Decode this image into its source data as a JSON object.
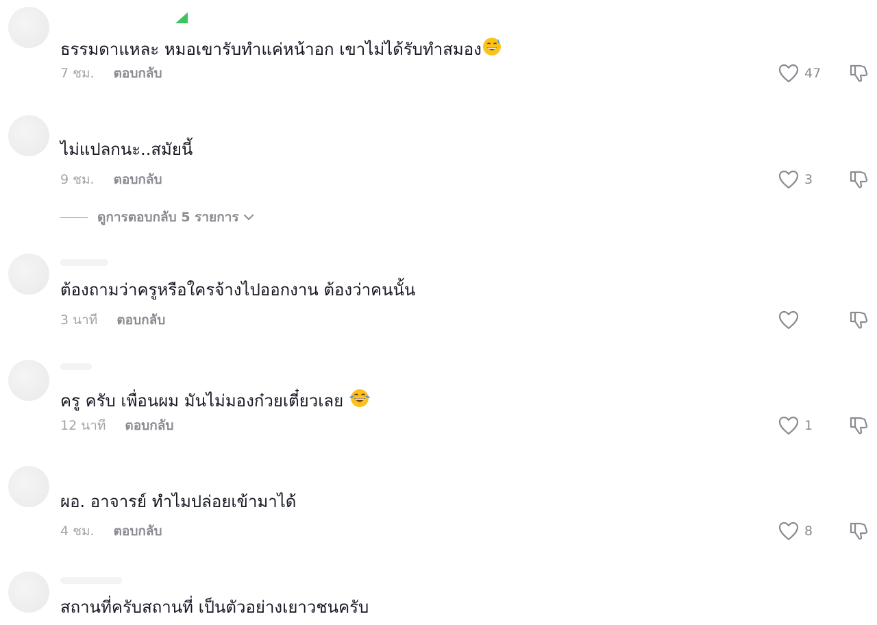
{
  "comments": [
    {
      "text": "ธรรมดาแหละ หมอเขารับทำแค่หน้าอก เขาไม่ได้รับทำสมอง",
      "emoji": "grinning-sweat-emoji",
      "time": "7 ชม.",
      "reply": "ตอบกลับ",
      "likes": "47"
    },
    {
      "text": "ไม่แปลกนะ..สมัยนี้",
      "time": "9 ชม.",
      "reply": "ตอบกลับ",
      "likes": "3"
    },
    {
      "text": "ต้องถามว่าครูหรือใครจ้างไปออกงาน ต้องว่าคนนั้น",
      "time": "3 นาที",
      "reply": "ตอบกลับ",
      "likes": ""
    },
    {
      "text": "ครู ครับ เพื่อนผม มันไม่มองก๋วยเตี๋ยวเลย",
      "emoji": "tears-of-joy-emoji",
      "time": "12 นาที",
      "reply": "ตอบกลับ",
      "likes": "1"
    },
    {
      "text": "ผอ. อาจารย์ ทำไมปล่อยเข้ามาได้",
      "time": "4 ชม.",
      "reply": "ตอบกลับ",
      "likes": "8"
    },
    {
      "text": "สถานที่ครับสถานที่ เป็นตัวอย่างเยาวชนครับ"
    }
  ],
  "view_replies": {
    "label": "ดูการตอบกลับ 5 รายการ"
  },
  "icons": {
    "like": "heart-outline-icon",
    "dislike": "thumbs-down-outline-icon",
    "expand": "chevron-down-icon"
  },
  "colors": {
    "text": "#161823",
    "muted": "#8a8b91",
    "time": "#a3a3a8",
    "icon": "#8a8b91"
  }
}
